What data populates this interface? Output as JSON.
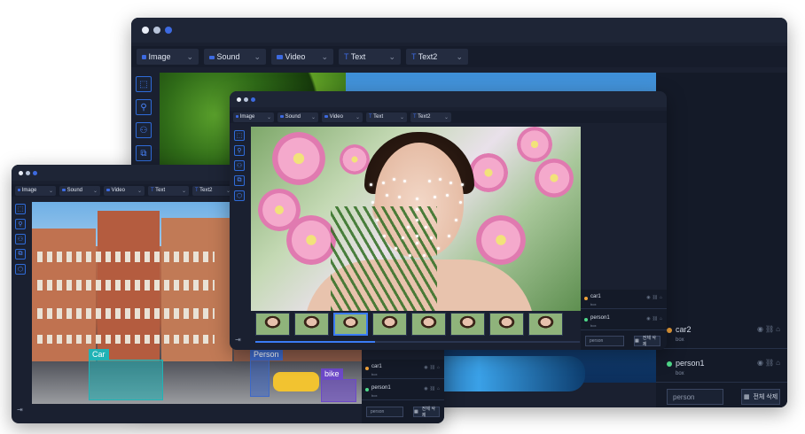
{
  "toolbar": {
    "image": "Image",
    "sound": "Sound",
    "video": "Video",
    "text": "Text",
    "text2": "Text2"
  },
  "annotations": {
    "car2": {
      "name": "car2",
      "sub": "box"
    },
    "person1": {
      "name": "person1",
      "sub": "box"
    },
    "class_search": "person",
    "delete_all": "전체 삭제"
  },
  "small_annotations": {
    "car1": {
      "name": "car1",
      "sub": "box"
    },
    "person1": {
      "name": "person1",
      "sub": "box"
    },
    "class_search": "person",
    "delete_all": "전체 삭제"
  },
  "bbox_labels": {
    "car": "Car",
    "person": "Person",
    "bike": "bike"
  },
  "video": {
    "progress": 0.37,
    "selected_frame": 3
  },
  "colors": {
    "accent": "#3a7bf5",
    "car": "#21b3b6",
    "person": "#3c68c8",
    "bike": "#6d49c8",
    "orange_dot": "#f0a23a",
    "green_dot": "#4fd98a"
  },
  "icons": [
    "close-icon",
    "minimize-icon",
    "maximize-icon",
    "bbox-tool-icon",
    "zoom-tool-icon",
    "person-tool-icon",
    "copy-tool-icon",
    "exit-icon",
    "eye-icon",
    "link-icon",
    "lock-icon",
    "trash-icon"
  ]
}
